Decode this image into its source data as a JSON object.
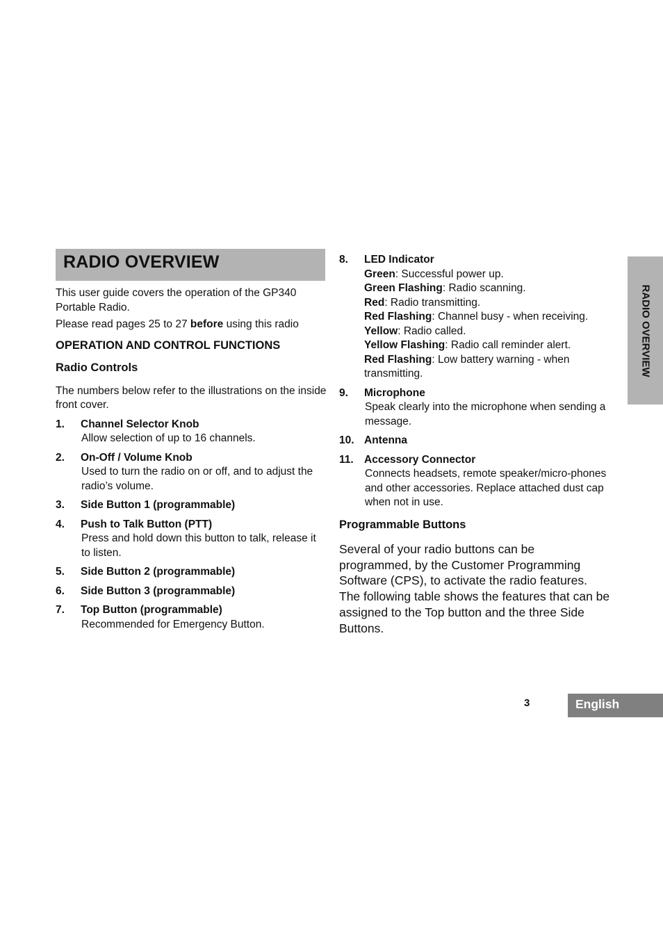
{
  "title": "RADIO OVERVIEW",
  "intro": {
    "line1": "This user guide covers the operation of the GP340 Portable Radio.",
    "line2_pre": "Please read pages 25 to 27 ",
    "line2_bold": "before",
    "line2_post": " using this radio"
  },
  "section_heading": "OPERATION AND CONTROL FUNCTIONS",
  "subsection_heading": "Radio Controls",
  "ref_note": "The numbers below refer to the illustrations on the inside front cover.",
  "left_items": [
    {
      "num": "1.",
      "title": "Channel Selector Knob",
      "desc": "Allow selection of up to 16 channels."
    },
    {
      "num": "2.",
      "title": "On-Off / Volume Knob",
      "desc": "Used to turn the radio on or off, and to adjust the radio’s volume."
    },
    {
      "num": "3.",
      "title": "Side Button 1 (programmable)",
      "desc": ""
    },
    {
      "num": "4.",
      "title": "Push to Talk Button (PTT)",
      "desc": "Press and hold down this button to talk, release it to listen."
    },
    {
      "num": "5.",
      "title": "Side Button 2 (programmable)",
      "desc": ""
    },
    {
      "num": "6.",
      "title": "Side Button 3 (programmable)",
      "desc": ""
    },
    {
      "num": "7.",
      "title": "Top Button (programmable)",
      "desc": "Recommended for Emergency Button."
    }
  ],
  "led": {
    "num": "8.",
    "title": "LED Indicator",
    "states": [
      {
        "label": "Green",
        "text": ": Successful power up."
      },
      {
        "label": "Green Flashing",
        "text": ": Radio scanning."
      },
      {
        "label": "Red",
        "text": ": Radio transmitting."
      },
      {
        "label": "Red Flashing",
        "text": ": Channel busy - when receiving."
      },
      {
        "label": "Yellow",
        "text": ": Radio called."
      },
      {
        "label": "Yellow Flashing",
        "text": ": Radio call reminder alert."
      },
      {
        "label": "Red Flashing",
        "text": ": Low battery warning - when transmitting."
      }
    ]
  },
  "right_items": [
    {
      "num": "9.",
      "title": "Microphone",
      "desc": "Speak clearly into the microphone when sending a message."
    },
    {
      "num": "10.",
      "title": "Antenna",
      "desc": ""
    },
    {
      "num": "11.",
      "title": "Accessory Connector",
      "desc": "Connects headsets, remote speaker/micro-phones and other accessories. Replace attached dust cap when not in use."
    }
  ],
  "programmable": {
    "heading": "Programmable Buttons",
    "body": "Several of your radio buttons can be programmed, by the Customer Programming Software (CPS), to activate the radio features. The following table shows the features that can be assigned to the Top button and the three Side Buttons."
  },
  "side_tab": "RADIO OVERVIEW",
  "footer": {
    "page_number": "3",
    "language": "English"
  }
}
